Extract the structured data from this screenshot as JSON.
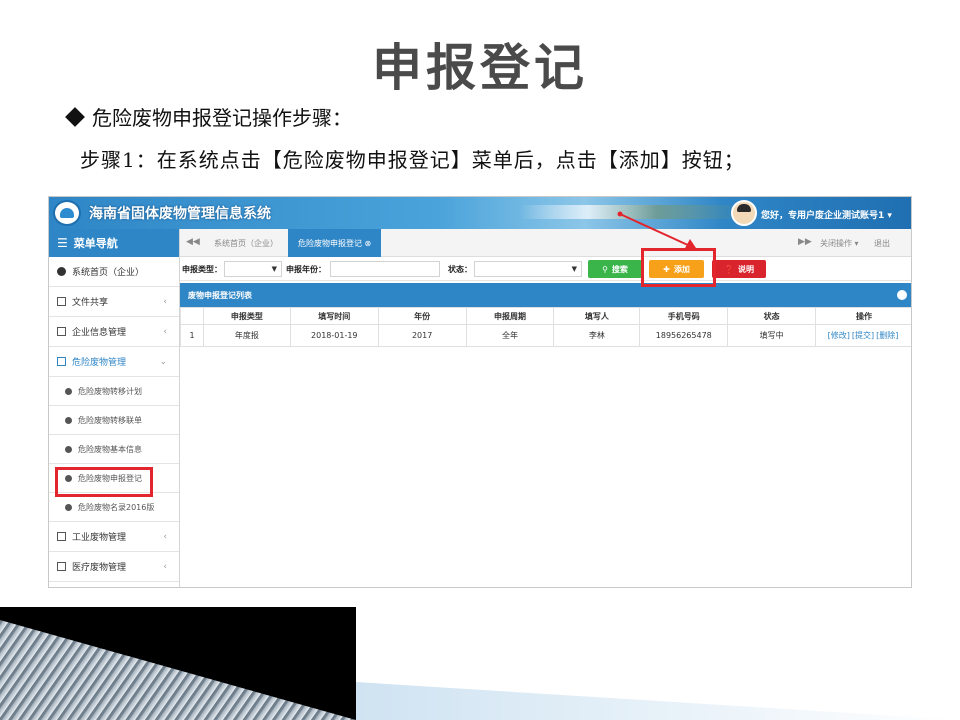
{
  "slide": {
    "title": "申报登记",
    "bullet": "危险废物申报登记操作步骤：",
    "step1": "步骤1：在系统点击【危险废物申报登记】菜单后，点击【添加】按钮；"
  },
  "app": {
    "title": "海南省固体废物管理信息系统",
    "user_greeting": "您好，专用户废企业测试账号1 ▾",
    "menu_header": "菜单导航",
    "sidebar": [
      {
        "label": "系统首页（企业）"
      },
      {
        "label": "文件共享"
      },
      {
        "label": "企业信息管理"
      },
      {
        "label": "危险废物管理"
      },
      {
        "label": "危险废物转移计划"
      },
      {
        "label": "危险废物转移联单"
      },
      {
        "label": "危险废物基本信息"
      },
      {
        "label": "危险废物申报登记"
      },
      {
        "label": "危险废物名录2016版"
      },
      {
        "label": "工业废物管理"
      },
      {
        "label": "医疗废物管理"
      }
    ],
    "tabs": {
      "home": "系统首页（企业）",
      "active": "危险废物申报登记 ⊗",
      "close_ops": "关闭操作 ▾",
      "exit": "退出"
    },
    "filters": {
      "type_label": "申报类型：",
      "year_label": "申报年份：",
      "status_label": "状态："
    },
    "buttons": {
      "search": "搜索",
      "add": "添加",
      "help": "说明"
    },
    "panel_title": "废物申报登记列表",
    "table": {
      "headers": [
        "",
        "申报类型",
        "填写时间",
        "年份",
        "申报周期",
        "填写人",
        "手机号码",
        "状态",
        "操作"
      ],
      "rows": [
        {
          "index": "1",
          "type": "年度报",
          "date": "2018-01-19",
          "year": "2017",
          "cycle": "全年",
          "filler": "李林",
          "phone": "18956265478",
          "status": "填写中",
          "op_edit": "[修改]",
          "op_submit": "[提交]",
          "op_delete": "[删除]"
        }
      ]
    }
  },
  "colors": {
    "header_blue": "#2f86c6",
    "search_green": "#39b54a",
    "add_orange": "#f7a11a",
    "help_red": "#d9232d",
    "highlight_red": "#e3262e"
  }
}
